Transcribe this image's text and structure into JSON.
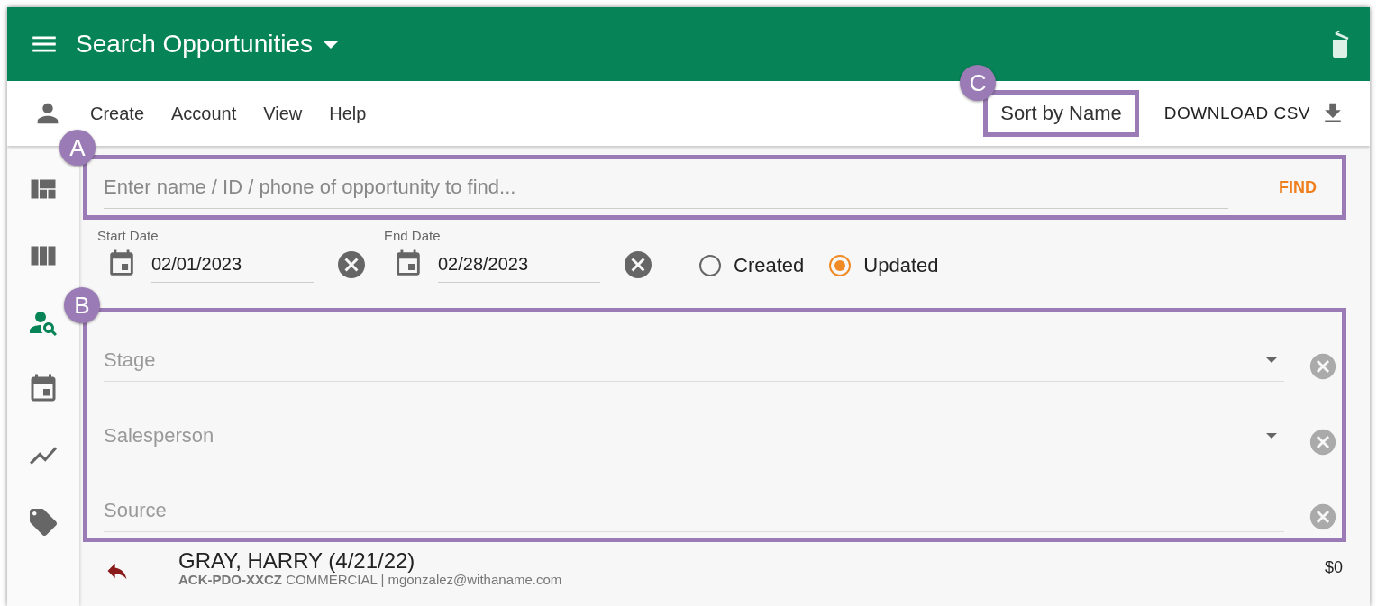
{
  "header": {
    "title": "Search Opportunities"
  },
  "toolbar": {
    "menu": [
      {
        "label": "Create"
      },
      {
        "label": "Account"
      },
      {
        "label": "View"
      },
      {
        "label": "Help"
      }
    ],
    "sort": {
      "label": "Sort by Name",
      "callout": "C"
    },
    "download": "DOWNLOAD CSV"
  },
  "sidebar": {
    "items": [
      {
        "kind": "quilt",
        "selected": false
      },
      {
        "kind": "columns",
        "selected": false
      },
      {
        "kind": "person-search",
        "selected": true
      },
      {
        "kind": "calendar",
        "selected": false
      },
      {
        "kind": "chart",
        "selected": false
      },
      {
        "kind": "tag",
        "selected": false
      }
    ]
  },
  "search": {
    "placeholder": "Enter name / ID / phone of opportunity to find...",
    "button": "FIND",
    "callout": "A"
  },
  "dates": [
    {
      "label": "Start Date",
      "value": "02/01/2023"
    },
    {
      "label": "End Date",
      "value": "02/28/2023"
    }
  ],
  "date_type": [
    {
      "label": "Created",
      "selected": false
    },
    {
      "label": "Updated",
      "selected": true
    }
  ],
  "filters": {
    "callout": "B",
    "items": [
      {
        "kind": "dropdown",
        "placeholder": "Stage"
      },
      {
        "kind": "dropdown",
        "placeholder": "Salesperson"
      },
      {
        "kind": "text",
        "placeholder": "Source"
      }
    ]
  },
  "results": [
    {
      "title": "GRAY, HARRY (4/21/22)",
      "code": "ACK-PDO-XXCZ",
      "details": "COMMERCIAL | mgonzalez@withaname.com",
      "amount": "$0"
    }
  ]
}
